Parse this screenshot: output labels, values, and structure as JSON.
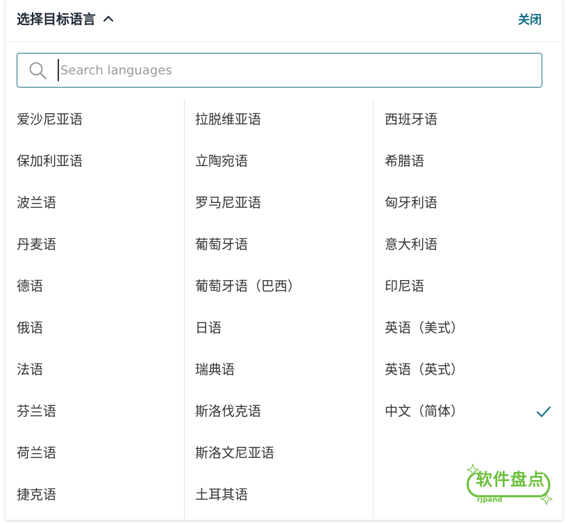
{
  "header": {
    "title": "选择目标语言",
    "close_label": "关闭"
  },
  "search": {
    "placeholder": "Search languages",
    "value": ""
  },
  "columns": {
    "col1": [
      "爱沙尼亚语",
      "保加利亚语",
      "波兰语",
      "丹麦语",
      "德语",
      "俄语",
      "法语",
      "芬兰语",
      "荷兰语",
      "捷克语"
    ],
    "col2": [
      "拉脱维亚语",
      "立陶宛语",
      "罗马尼亚语",
      "葡萄牙语",
      "葡萄牙语（巴西）",
      "日语",
      "瑞典语",
      "斯洛伐克语",
      "斯洛文尼亚语",
      "土耳其语"
    ],
    "col3": [
      "西班牙语",
      "希腊语",
      "匈牙利语",
      "意大利语",
      "印尼语",
      "英语（美式）",
      "英语（英式）",
      "中文（简体）"
    ]
  },
  "selected_language": "中文（简体）",
  "watermark": {
    "text": "软件盘点",
    "subtext": "rjpand"
  },
  "colors": {
    "accent": "#0f6b83",
    "search_border": "#1c6f86",
    "text": "#333333",
    "check": "#1a6f8a",
    "watermark": "#6bbf3a"
  },
  "icons": {
    "title_toggle": "chevron-up-icon",
    "search": "search-icon",
    "selected": "checkmark-icon"
  }
}
